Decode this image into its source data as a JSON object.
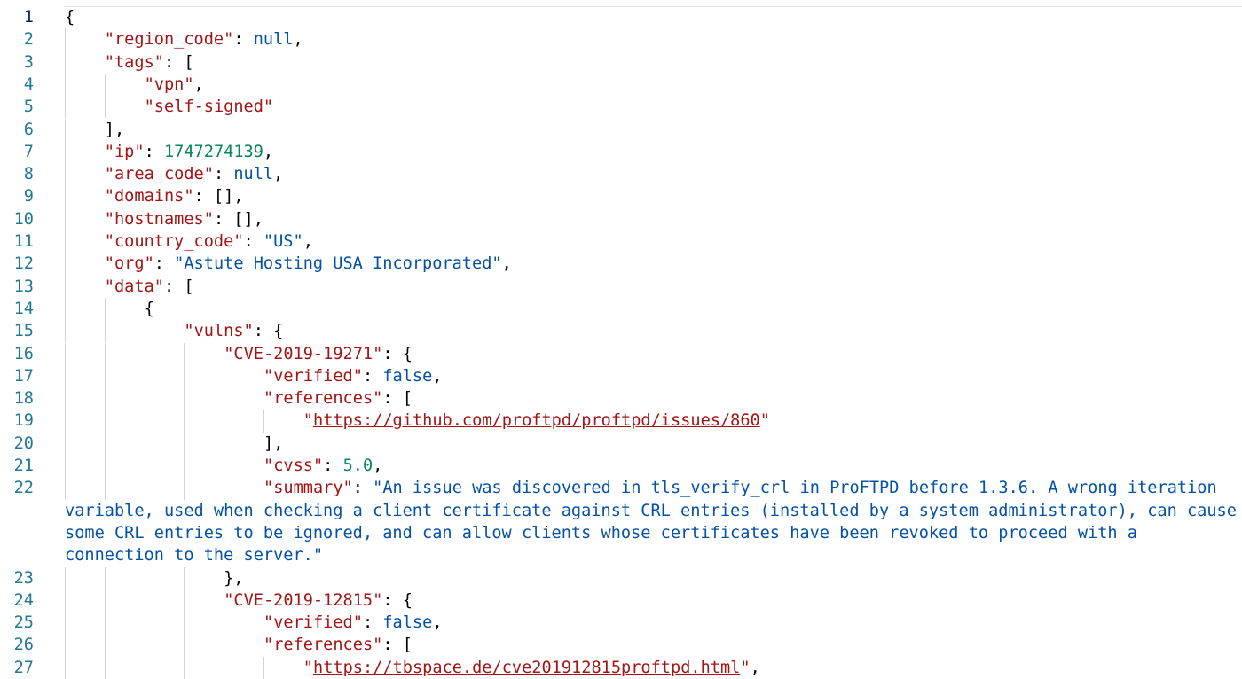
{
  "editor": {
    "lines": [
      {
        "n": "1",
        "tokens": [
          {
            "t": "p",
            "v": "{"
          }
        ]
      },
      {
        "n": "2",
        "tokens": [
          {
            "t": "k",
            "v": "\"region_code\""
          },
          {
            "t": "p",
            "v": ": "
          },
          {
            "t": "b",
            "v": "null"
          },
          {
            "t": "p",
            "v": ","
          }
        ]
      },
      {
        "n": "3",
        "tokens": [
          {
            "t": "k",
            "v": "\"tags\""
          },
          {
            "t": "p",
            "v": ": ["
          }
        ]
      },
      {
        "n": "4",
        "tokens": [
          {
            "t": "k",
            "v": "\"vpn\""
          },
          {
            "t": "p",
            "v": ","
          }
        ]
      },
      {
        "n": "5",
        "tokens": [
          {
            "t": "k",
            "v": "\"self-signed\""
          }
        ]
      },
      {
        "n": "6",
        "tokens": [
          {
            "t": "p",
            "v": "],"
          }
        ]
      },
      {
        "n": "7",
        "tokens": [
          {
            "t": "k",
            "v": "\"ip\""
          },
          {
            "t": "p",
            "v": ": "
          },
          {
            "t": "n",
            "v": "1747274139"
          },
          {
            "t": "p",
            "v": ","
          }
        ]
      },
      {
        "n": "8",
        "tokens": [
          {
            "t": "k",
            "v": "\"area_code\""
          },
          {
            "t": "p",
            "v": ": "
          },
          {
            "t": "b",
            "v": "null"
          },
          {
            "t": "p",
            "v": ","
          }
        ]
      },
      {
        "n": "9",
        "tokens": [
          {
            "t": "k",
            "v": "\"domains\""
          },
          {
            "t": "p",
            "v": ": [],"
          }
        ]
      },
      {
        "n": "10",
        "tokens": [
          {
            "t": "k",
            "v": "\"hostnames\""
          },
          {
            "t": "p",
            "v": ": [],"
          }
        ]
      },
      {
        "n": "11",
        "tokens": [
          {
            "t": "k",
            "v": "\"country_code\""
          },
          {
            "t": "p",
            "v": ": "
          },
          {
            "t": "s",
            "v": "\"US\""
          },
          {
            "t": "p",
            "v": ","
          }
        ]
      },
      {
        "n": "12",
        "tokens": [
          {
            "t": "k",
            "v": "\"org\""
          },
          {
            "t": "p",
            "v": ": "
          },
          {
            "t": "s",
            "v": "\"Astute Hosting USA Incorporated\""
          },
          {
            "t": "p",
            "v": ","
          }
        ]
      },
      {
        "n": "13",
        "tokens": [
          {
            "t": "k",
            "v": "\"data\""
          },
          {
            "t": "p",
            "v": ": ["
          }
        ]
      },
      {
        "n": "14",
        "tokens": [
          {
            "t": "p",
            "v": "{"
          }
        ]
      },
      {
        "n": "15",
        "tokens": [
          {
            "t": "k",
            "v": "\"vulns\""
          },
          {
            "t": "p",
            "v": ": {"
          }
        ]
      },
      {
        "n": "16",
        "tokens": [
          {
            "t": "k",
            "v": "\"CVE-2019-19271\""
          },
          {
            "t": "p",
            "v": ": {"
          }
        ]
      },
      {
        "n": "17",
        "tokens": [
          {
            "t": "k",
            "v": "\"verified\""
          },
          {
            "t": "p",
            "v": ": "
          },
          {
            "t": "b",
            "v": "false"
          },
          {
            "t": "p",
            "v": ","
          }
        ]
      },
      {
        "n": "18",
        "tokens": [
          {
            "t": "k",
            "v": "\"references\""
          },
          {
            "t": "p",
            "v": ": ["
          }
        ]
      },
      {
        "n": "19",
        "tokens": [
          {
            "t": "k",
            "v": "\""
          },
          {
            "t": "u",
            "v": "https://github.com/proftpd/proftpd/issues/860"
          },
          {
            "t": "k",
            "v": "\""
          }
        ]
      },
      {
        "n": "20",
        "tokens": [
          {
            "t": "p",
            "v": "],"
          }
        ]
      },
      {
        "n": "21",
        "tokens": [
          {
            "t": "k",
            "v": "\"cvss\""
          },
          {
            "t": "p",
            "v": ": "
          },
          {
            "t": "n",
            "v": "5.0"
          },
          {
            "t": "p",
            "v": ","
          }
        ]
      },
      {
        "n": "22",
        "tokens": [
          {
            "t": "k",
            "v": "\"summary\""
          },
          {
            "t": "p",
            "v": ": "
          },
          {
            "t": "s",
            "v": "\"An issue was discovered in tls_verify_crl in ProFTPD before 1.3.6. A wrong iteration"
          }
        ]
      },
      {
        "n": "23",
        "tokens": [
          {
            "t": "p",
            "v": "},"
          }
        ]
      },
      {
        "n": "24",
        "tokens": [
          {
            "t": "k",
            "v": "\"CVE-2019-12815\""
          },
          {
            "t": "p",
            "v": ": {"
          }
        ]
      },
      {
        "n": "25",
        "tokens": [
          {
            "t": "k",
            "v": "\"verified\""
          },
          {
            "t": "p",
            "v": ": "
          },
          {
            "t": "b",
            "v": "false"
          },
          {
            "t": "p",
            "v": ","
          }
        ]
      },
      {
        "n": "26",
        "tokens": [
          {
            "t": "k",
            "v": "\"references\""
          },
          {
            "t": "p",
            "v": ": ["
          }
        ]
      },
      {
        "n": "27",
        "tokens": [
          {
            "t": "k",
            "v": "\""
          },
          {
            "t": "u",
            "v": "https://tbspace.de/cve201912815proftpd.html"
          },
          {
            "t": "k",
            "v": "\""
          },
          {
            "t": "p",
            "v": ","
          }
        ]
      }
    ],
    "summary_wrap": [
      "variable, used when checking a client certificate against CRL entries (installed by a system administrator), can cause",
      "some CRL entries to be ignored, and can allow clients whose certificates have been revoked to proceed with a",
      "connection to the server.\""
    ],
    "colors": {
      "key": "#a31515",
      "string": "#0451a5",
      "number": "#098658",
      "keyword": "#0451a5",
      "line_number": "#237893",
      "current_line_number": "#0b216f"
    }
  }
}
